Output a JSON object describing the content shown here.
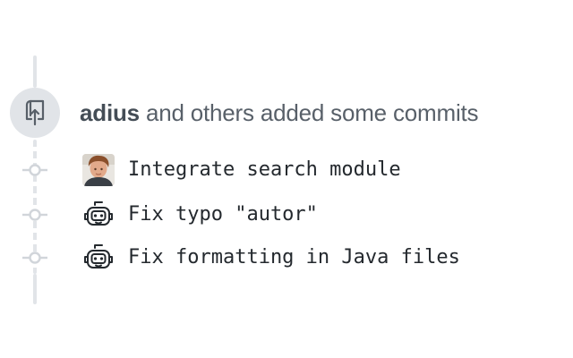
{
  "timeline": {
    "event_icon": "repo-push-icon",
    "heading": {
      "author": "adius",
      "action_text": "and others added some commits"
    },
    "commits": [
      {
        "avatar": "human-photo-avatar",
        "message": "Integrate search module"
      },
      {
        "avatar": "robot-avatar",
        "message": "Fix typo \"autor\""
      },
      {
        "avatar": "robot-avatar",
        "message": "Fix formatting in Java files"
      }
    ]
  },
  "colors": {
    "rail": "#e1e4e8",
    "badge_bg": "#e1e4e8",
    "icon": "#586069",
    "heading_text": "#586069",
    "author_text": "#444d56",
    "commit_text": "#24292e"
  }
}
